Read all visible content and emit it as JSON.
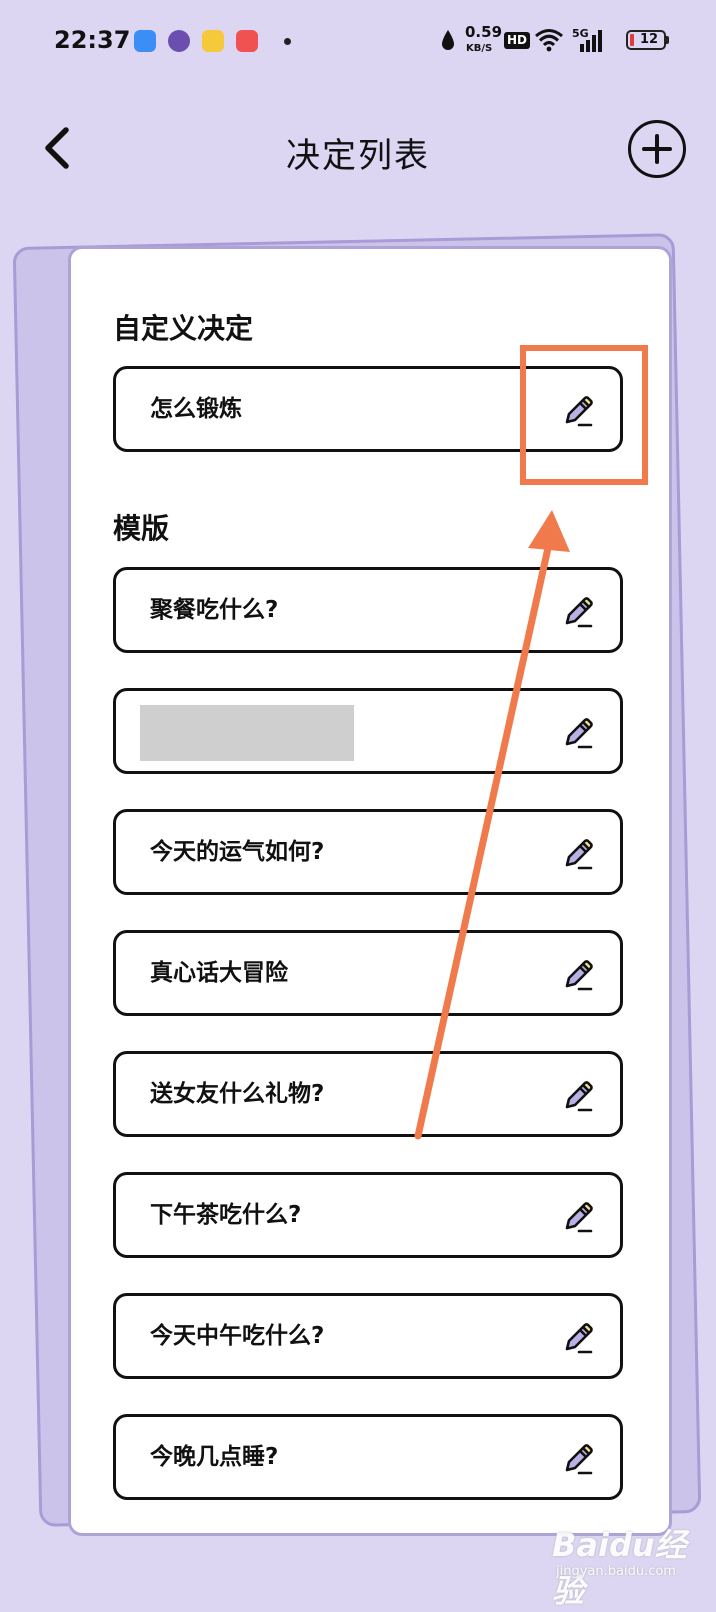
{
  "status_bar": {
    "time": "22:37",
    "net_speed_value": "0.59",
    "net_speed_unit": "KB/S",
    "hd_badge": "HD",
    "network_type": "5G",
    "battery_level": "12"
  },
  "nav": {
    "back_icon": "chevron-left-icon",
    "title": "决定列表",
    "add_icon": "plus-circle-icon"
  },
  "custom_section": {
    "title": "自定义决定",
    "items": [
      {
        "label": "怎么锻炼"
      }
    ]
  },
  "template_section": {
    "title": "模版",
    "items": [
      {
        "label": "聚餐吃什么?"
      },
      {
        "label": ""
      },
      {
        "label": "今天的运气如何?"
      },
      {
        "label": "真心话大冒险"
      },
      {
        "label": "送女友什么礼物?"
      },
      {
        "label": "下午茶吃什么?"
      },
      {
        "label": "今天中午吃什么?"
      },
      {
        "label": "今晚几点睡?"
      }
    ]
  },
  "edit_icon": "pencil-icon",
  "colors": {
    "background": "#dcd6f2",
    "card_border": "#aea3d6",
    "annotation": "#f07a4b",
    "pencil_fill": "#b9b1e6",
    "pencil_tip": "#f2e38a"
  },
  "watermark": {
    "logo": "Baidu经验",
    "url": "jingyan.baidu.com"
  }
}
